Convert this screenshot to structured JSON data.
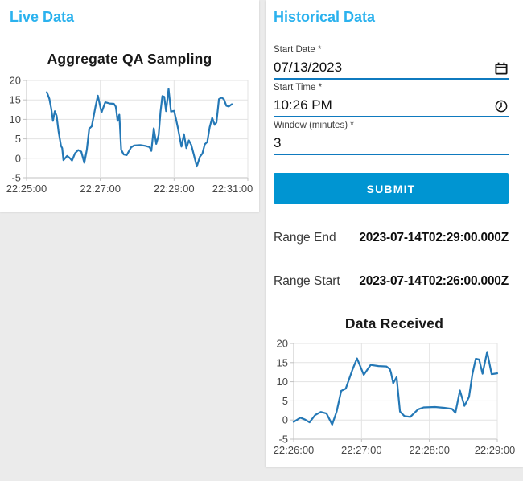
{
  "colors": {
    "accent": "#2bb2ee",
    "submit": "#0095d2",
    "underline": "#0f7abf",
    "grid": "#e3e3e3",
    "axis": "#c2c2c2",
    "line": "#2478b6"
  },
  "live_panel": {
    "title": "Live Data"
  },
  "historical_panel": {
    "title": "Historical Data",
    "fields": [
      {
        "label": "Start Date *",
        "value": "07/13/2023",
        "icon": "calendar-icon"
      },
      {
        "label": "Start Time *",
        "value": "10:26 PM",
        "icon": "clock-icon"
      },
      {
        "label": "Window (minutes) *",
        "value": "3",
        "icon": ""
      }
    ],
    "submit_label": "SUBMIT",
    "results": [
      {
        "label": "Range End",
        "value": "2023-07-14T02:29:00.000Z"
      },
      {
        "label": "Range Start",
        "value": "2023-07-14T02:26:00.000Z"
      }
    ]
  },
  "chart_data": [
    {
      "id": "live",
      "type": "line",
      "title": "Aggregate QA Sampling",
      "x_ticks": [
        "22:25:00",
        "22:27:00",
        "22:29:00",
        "22:31:00"
      ],
      "x_tick_values": [
        0,
        120,
        240,
        360
      ],
      "xlim": [
        0,
        360
      ],
      "y_ticks": [
        -5,
        0,
        5,
        10,
        15,
        20
      ],
      "ylim": [
        -5,
        20
      ],
      "grid": true,
      "legend": "none",
      "line_color": "#2478b6",
      "x_unit": "seconds after 22:25:00",
      "points": [
        [
          33,
          17
        ],
        [
          37,
          15.3
        ],
        [
          40,
          12.9
        ],
        [
          43,
          9.6
        ],
        [
          46,
          12.1
        ],
        [
          49,
          10.9
        ],
        [
          52,
          7
        ],
        [
          56,
          3.2
        ],
        [
          58,
          2.6
        ],
        [
          60,
          -0.5
        ],
        [
          66,
          0.6
        ],
        [
          70,
          0.1
        ],
        [
          74,
          -0.6
        ],
        [
          79,
          1.3
        ],
        [
          84,
          2.1
        ],
        [
          89,
          1.7
        ],
        [
          94,
          -1.2
        ],
        [
          98,
          2.2
        ],
        [
          102,
          7.6
        ],
        [
          106,
          8.2
        ],
        [
          112,
          13.2
        ],
        [
          116,
          16.1
        ],
        [
          122,
          11.8
        ],
        [
          128,
          14.4
        ],
        [
          135,
          14.1
        ],
        [
          142,
          14
        ],
        [
          145,
          13.3
        ],
        [
          146,
          12.4
        ],
        [
          148,
          9.6
        ],
        [
          151,
          11.2
        ],
        [
          154,
          2.2
        ],
        [
          158,
          1
        ],
        [
          163,
          0.8
        ],
        [
          170,
          2.8
        ],
        [
          175,
          3.3
        ],
        [
          185,
          3.4
        ],
        [
          193,
          3.2
        ],
        [
          200,
          2.9
        ],
        [
          203,
          1.9
        ],
        [
          207,
          7.7
        ],
        [
          211,
          3.7
        ],
        [
          215,
          6
        ],
        [
          218,
          12
        ],
        [
          221,
          16
        ],
        [
          224,
          15.8
        ],
        [
          227,
          12.1
        ],
        [
          231,
          17.8
        ],
        [
          235,
          12
        ],
        [
          240,
          12.2
        ],
        [
          243,
          10.2
        ],
        [
          246,
          8
        ],
        [
          249,
          5.5
        ],
        [
          252,
          3
        ],
        [
          256,
          6.2
        ],
        [
          260,
          2.6
        ],
        [
          264,
          4.6
        ],
        [
          268,
          3.4
        ],
        [
          272,
          1
        ],
        [
          277,
          -2.1
        ],
        [
          282,
          0.4
        ],
        [
          286,
          1.2
        ],
        [
          290,
          3.6
        ],
        [
          294,
          4.2
        ],
        [
          298,
          8
        ],
        [
          302,
          10.4
        ],
        [
          306,
          8.6
        ],
        [
          309,
          9.2
        ],
        [
          313,
          15.2
        ],
        [
          317,
          15.6
        ],
        [
          321,
          15.2
        ],
        [
          325,
          13.5
        ],
        [
          329,
          13.3
        ],
        [
          334,
          13.9
        ]
      ]
    },
    {
      "id": "received",
      "type": "line",
      "title": "Data Received",
      "x_ticks": [
        "22:26:00",
        "22:27:00",
        "22:28:00",
        "22:29:00"
      ],
      "x_tick_values": [
        0,
        60,
        120,
        180
      ],
      "xlim": [
        0,
        180
      ],
      "y_ticks": [
        -5,
        0,
        5,
        10,
        15,
        20
      ],
      "ylim": [
        -5,
        20
      ],
      "grid": true,
      "legend": "none",
      "line_color": "#2478b6",
      "x_unit": "seconds after 22:26:00",
      "points": [
        [
          0,
          -0.5
        ],
        [
          6,
          0.6
        ],
        [
          10,
          0.1
        ],
        [
          14,
          -0.6
        ],
        [
          19,
          1.3
        ],
        [
          24,
          2.1
        ],
        [
          29,
          1.7
        ],
        [
          34,
          -1.2
        ],
        [
          38,
          2.2
        ],
        [
          42,
          7.6
        ],
        [
          46,
          8.2
        ],
        [
          52,
          13.2
        ],
        [
          56,
          16.1
        ],
        [
          62,
          11.8
        ],
        [
          68,
          14.4
        ],
        [
          75,
          14.1
        ],
        [
          82,
          14
        ],
        [
          85,
          13.3
        ],
        [
          86,
          12.4
        ],
        [
          88,
          9.6
        ],
        [
          91,
          11.2
        ],
        [
          94,
          2.2
        ],
        [
          98,
          1
        ],
        [
          103,
          0.8
        ],
        [
          110,
          2.8
        ],
        [
          115,
          3.3
        ],
        [
          125,
          3.4
        ],
        [
          133,
          3.2
        ],
        [
          140,
          2.9
        ],
        [
          143,
          1.9
        ],
        [
          147,
          7.7
        ],
        [
          151,
          3.7
        ],
        [
          155,
          6
        ],
        [
          158,
          12
        ],
        [
          161,
          16
        ],
        [
          164,
          15.8
        ],
        [
          167,
          12.1
        ],
        [
          171,
          17.8
        ],
        [
          175,
          12
        ],
        [
          180,
          12.2
        ]
      ]
    }
  ]
}
